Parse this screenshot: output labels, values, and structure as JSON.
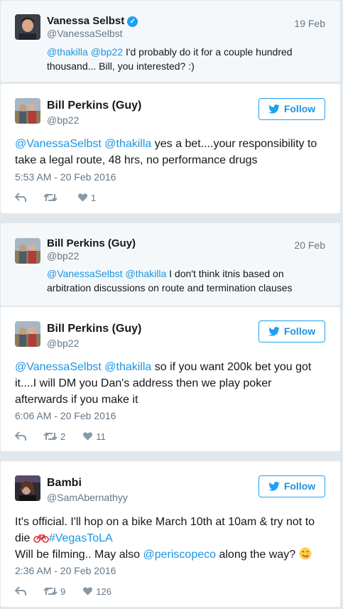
{
  "colors": {
    "link": "#1b95e0",
    "accent": "#1da1f2",
    "muted": "#657786",
    "icon": "#8899a6"
  },
  "tweets": [
    {
      "name": "Vanessa Selbst",
      "verified": true,
      "handle": "@VanessaSelbst",
      "date": "19 Feb",
      "mention1": "@thakilla",
      "mention2": "@bp22",
      "text_line1_rest": "I'd probably do it for a couple hundred",
      "text_line2": "thousand... Bill, you interested? :)"
    },
    {
      "name": "Bill Perkins (Guy)",
      "handle": "@bp22",
      "follow_label": "Follow",
      "mention1": "@VanessaSelbst",
      "mention2": "@thakilla",
      "text_line1_rest": "yes a bet....your responsibility to",
      "text_line2": "take a legal route, 48 hrs, no performance drugs",
      "timestamp": "5:53 AM - 20 Feb 2016",
      "retweets": "",
      "likes": "1"
    },
    {
      "name": "Bill Perkins (Guy)",
      "handle": "@bp22",
      "date": "20 Feb",
      "mention1": "@VanessaSelbst",
      "mention2": "@thakilla",
      "text_line1_rest": "I don't think itnis based on",
      "text_line2": "arbitration discussions on route and termination clauses"
    },
    {
      "name": "Bill Perkins (Guy)",
      "handle": "@bp22",
      "follow_label": "Follow",
      "mention1": "@VanessaSelbst",
      "mention2": "@thakilla",
      "text_line1_rest": "so if you want 200k bet you got",
      "text_line2": "it....I will DM you Dan's address then we play poker",
      "text_line3": "afterwards if you make it",
      "timestamp": "6:06 AM - 20 Feb 2016",
      "retweets": "2",
      "likes": "11"
    },
    {
      "name": "Bambi",
      "handle": "@SamAbernathyy",
      "follow_label": "Follow",
      "text_line1": "It's official. I'll hop on a bike March 10th at 10am & try not to",
      "text_line2_pre": "die",
      "hashtag": "#VegasToLA",
      "text_line3_pre": "Will be filming.. May also",
      "mention": "@periscopeco",
      "text_line3_post": "along the way?",
      "timestamp": "2:36 AM - 20 Feb 2016",
      "retweets": "9",
      "likes": "126"
    }
  ],
  "icons": {
    "verified": "verified-badge-icon",
    "bird": "twitter-bird-icon",
    "reply": "reply-icon",
    "retweet": "retweet-icon",
    "like": "heart-icon",
    "bike": "bicycle-emoji-icon",
    "face": "yum-face-emoji-icon"
  }
}
